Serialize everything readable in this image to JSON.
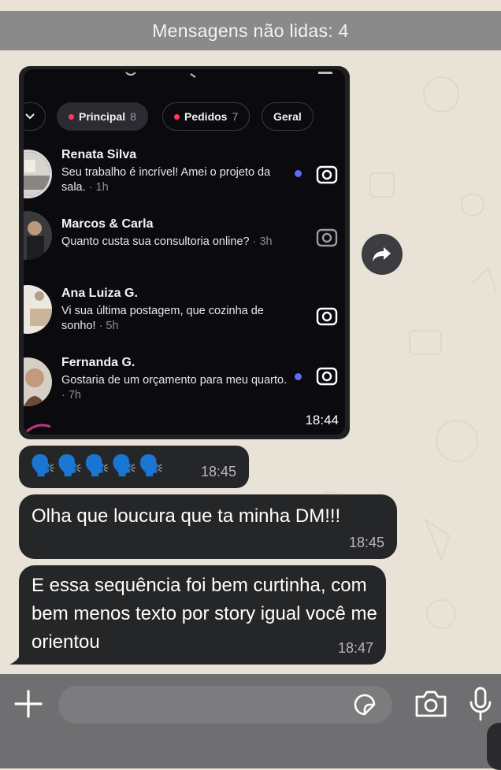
{
  "unread_banner": "Mensagens não lidas: 4",
  "screenshot_message": {
    "time": "18:44",
    "tabs": [
      {
        "label": "Principal",
        "count": "8"
      },
      {
        "label": "Pedidos",
        "count": "7"
      },
      {
        "label": "Geral",
        "count": ""
      }
    ],
    "conversations": [
      {
        "name": "Renata Silva",
        "message": "Seu trabalho é incrível! Amei o projeto da sala.",
        "time": "· 1h",
        "unread": true,
        "avatar": "avatar-living-room"
      },
      {
        "name": "Marcos & Carla",
        "message": "Quanto custa sua consultoria online?",
        "time": "· 3h",
        "unread": false,
        "avatar": "avatar-couple"
      },
      {
        "name": "Ana Luiza G.",
        "message": "Vi sua última postagem, que cozinha de sonho!",
        "time": "· 5h",
        "unread": false,
        "avatar": "avatar-kitchen"
      },
      {
        "name": "Fernanda G.",
        "message": "Gostaria de um orçamento para meu quarto.",
        "time": "· 7h",
        "unread": true,
        "avatar": "avatar-woman"
      }
    ]
  },
  "emoji_message": {
    "emojis": "🗣️🗣️🗣️🗣️🗣️",
    "time": "18:45"
  },
  "messages": [
    {
      "text": "Olha que loucura que ta minha DM!!!",
      "time": "18:45"
    },
    {
      "text": "E essa sequência foi bem curtinha, com bem menos texto por story igual você me orientou",
      "time": "18:47"
    }
  ],
  "colors": {
    "bubble": "#252628",
    "unread_dot": "#5b6ef5",
    "request_dot": "#ff3b5c",
    "bottom_bar": "#6f6f71"
  }
}
